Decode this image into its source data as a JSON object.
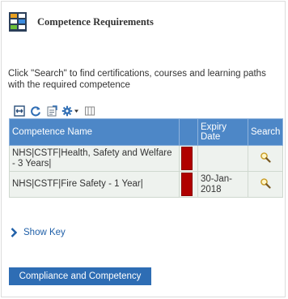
{
  "panel": {
    "title": "Competence Requirements",
    "instructions": "Click \"Search\" to find certifications, courses and learning paths with the required competence"
  },
  "toolbar": {
    "icons": [
      "fit-columns-icon",
      "refresh-icon",
      "export-icon",
      "settings-icon",
      "column-chooser-icon"
    ]
  },
  "grid": {
    "columns": {
      "name": "Competence Name",
      "status": "",
      "expiry": "Expiry Date",
      "search": "Search"
    },
    "rows": [
      {
        "name": "NHS|CSTF|Health, Safety and Welfare - 3 Years|",
        "status_color": "#b00000",
        "expiry": ""
      },
      {
        "name": "NHS|CSTF|Fire Safety - 1 Year|",
        "status_color": "#b00000",
        "expiry": "30-Jan-2018"
      }
    ]
  },
  "show_key": {
    "label": "Show Key"
  },
  "cta": {
    "label": "Compliance and Competency"
  },
  "colors": {
    "header_blue": "#4d87c7",
    "button_blue": "#2e6db4",
    "status_red": "#b00000",
    "link_blue": "#1f5fa8"
  }
}
